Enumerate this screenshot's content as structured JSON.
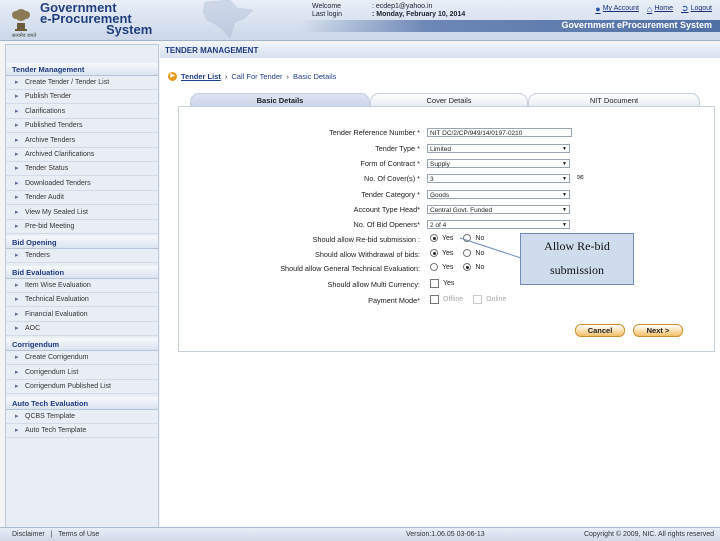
{
  "header": {
    "logo_line1": "Government",
    "logo_line2": "e-Procurement",
    "logo_line3": "System",
    "logo_sub": "सत्यमेव जयते",
    "welcome_label": "Welcome",
    "welcome_value": ": ecdep1@yahoo.in",
    "lastlogin_label": "Last login",
    "lastlogin_value": ": Monday, February 10, 2014",
    "my_account": "My Account",
    "home": "Home",
    "logout": "Logout",
    "banner_text": "Government eProcurement System"
  },
  "sidebar": {
    "sections": [
      {
        "title": "Tender Management",
        "items": [
          "Create Tender / Tender List",
          "Publish Tender",
          "Clarifications",
          "Published Tenders",
          "Archive Tenders",
          "Archived Clarifications",
          "Tender Status",
          "Downloaded Tenders",
          "Tender Audit",
          "View My Sealed List",
          "Pre-bid Meeting"
        ]
      },
      {
        "title": "Bid Opening",
        "items": [
          "Tenders"
        ]
      },
      {
        "title": "Bid Evaluation",
        "items": [
          "Item Wise Evaluation",
          "Technical Evaluation",
          "Financial Evaluation",
          "AOC"
        ]
      },
      {
        "title": "Corrigendum",
        "items": [
          "Create Corrigendum",
          "Corrigendum List",
          "Corrigendum Published List"
        ]
      },
      {
        "title": "Auto Tech Evaluation",
        "items": [
          "QCBS Template",
          "Auto Tech Template"
        ]
      }
    ]
  },
  "main": {
    "title": "TENDER MANAGEMENT",
    "breadcrumbs": [
      "Tender List",
      "Call For Tender",
      "Basic Details"
    ],
    "tabs": [
      "Basic Details",
      "Cover Details",
      "NIT Document"
    ]
  },
  "form": {
    "ref_label": "Tender Reference Number *",
    "ref_value": "NIT DC/2/CP/949/14/0197-0210",
    "type_label": "Tender Type *",
    "type_value": "Limited",
    "contract_label": "Form of Contract *",
    "contract_value": "Supply",
    "covers_label": "No. Of Cover(s) *",
    "covers_value": "3",
    "category_label": "Tender Category *",
    "category_value": "Goods",
    "account_label": "Account Type Head*",
    "account_value": "Central Govt. Funded",
    "bid_openers_label": "No. Of Bid Openers*",
    "bid_openers_value": "2 of 4",
    "rebid_label": "Should allow Re-bid submission :",
    "withdrawal_label": "Should allow Withdrawal of bids:",
    "general_tech_label": "Should allow General Technical Evaluation:",
    "multi_currency_label": "Should allow Multi Currency:",
    "payment_label": "Payment Mode*",
    "opt_yes": "Yes",
    "opt_no": "No",
    "opt_offline": "Offline",
    "opt_online": "Online",
    "cancel_label": "Cancel",
    "next_label": "Next >"
  },
  "callout": {
    "line1": "Allow Re-bid",
    "line2": "submission"
  },
  "footer": {
    "disclaimer": "Disclaimer",
    "terms": "Terms of Use",
    "version": "Version:1.06.05 03-06-13",
    "copyright": "Copyright © 2009, NIC. All rights reserved"
  }
}
